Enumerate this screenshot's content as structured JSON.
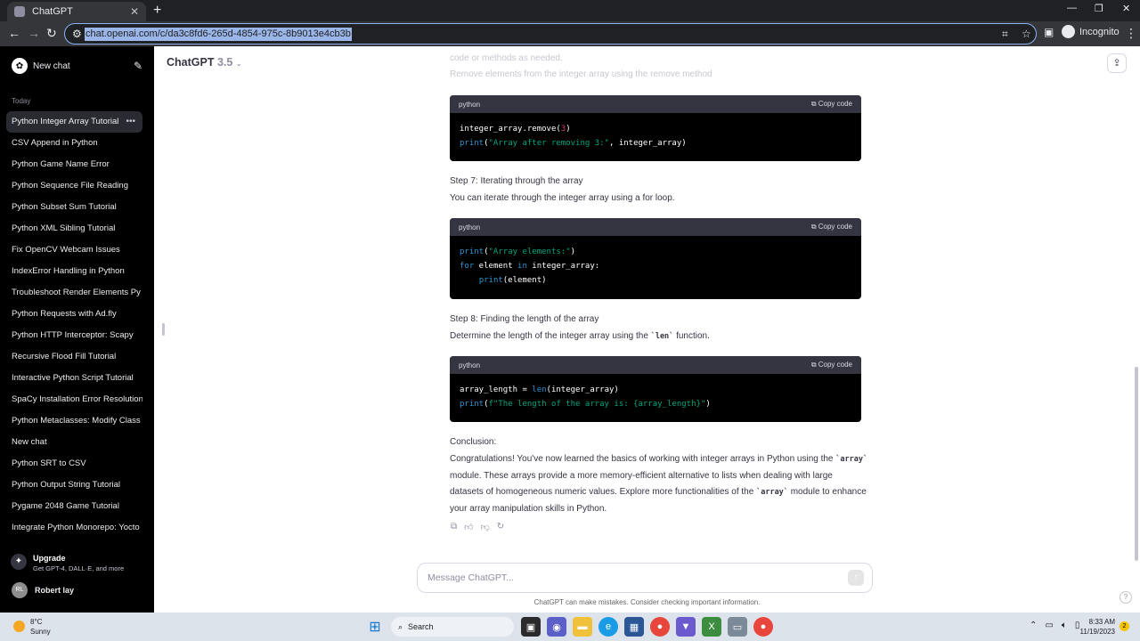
{
  "browser": {
    "tab_title": "ChatGPT",
    "url": "chat.openai.com/c/da3c8fd6-265d-4854-975c-8b9013e4cb3b",
    "profile_label": "Incognito"
  },
  "sidebar": {
    "new_chat_label": "New chat",
    "section_today": "Today",
    "chats": [
      "Python Integer Array Tutorial",
      "CSV Append in Python",
      "Python Game Name Error",
      "Python Sequence File Reading",
      "Python Subset Sum Tutorial",
      "Python XML Sibling Tutorial",
      "Fix OpenCV Webcam Issues",
      "IndexError Handling in Python",
      "Troubleshoot Render Elements Py",
      "Python Requests with Ad.fly",
      "Python HTTP Interceptor: Scapy",
      "Recursive Flood Fill Tutorial",
      "Interactive Python Script Tutorial",
      "SpaCy Installation Error Resolution",
      "Python Metaclasses: Modify Class",
      "New chat",
      "Python SRT to CSV",
      "Python Output String Tutorial",
      "Pygame 2048 Game Tutorial",
      "Integrate Python Monorepo: Yocto"
    ],
    "upgrade_title": "Upgrade",
    "upgrade_sub": "Get GPT-4, DALL·E, and more",
    "user_initials": "RL",
    "user_name": "Robert lay"
  },
  "main": {
    "model_name": "ChatGPT",
    "model_version": "3.5",
    "faded_line1": "code or methods as needed.",
    "faded_line2": "Remove elements from the integer array using the remove method",
    "blocks": [
      {
        "lang": "python",
        "copy": "Copy code"
      },
      {
        "lang": "python",
        "copy": "Copy code"
      },
      {
        "lang": "python",
        "copy": "Copy code"
      }
    ],
    "step7_title": "Step 7: Iterating through the array",
    "step7_desc": "You can iterate through the integer array using a for loop.",
    "step8_title": "Step 8: Finding the length of the array",
    "step8_desc_a": "Determine the length of the integer array using the ",
    "step8_code": "`len`",
    "step8_desc_b": " function.",
    "conclusion_title": "Conclusion:",
    "concl_1": "Congratulations! You've now learned the basics of working with integer arrays in Python using the",
    "concl_code1": "`array`",
    "concl_2": " module. These arrays provide a more memory-efficient alternative to lists when dealing",
    "concl_3": "with large datasets of homogeneous numeric values. Explore more functionalities of the ",
    "concl_code2": "`array`",
    "concl_4": "module to enhance your array manipulation skills in Python.",
    "input_placeholder": "Message ChatGPT...",
    "disclaimer": "ChatGPT can make mistakes. Consider checking important information."
  },
  "taskbar": {
    "weather_temp": "8°C",
    "weather_cond": "Sunny",
    "search_label": "Search",
    "time": "8:33 AM",
    "date": "11/19/2023"
  }
}
